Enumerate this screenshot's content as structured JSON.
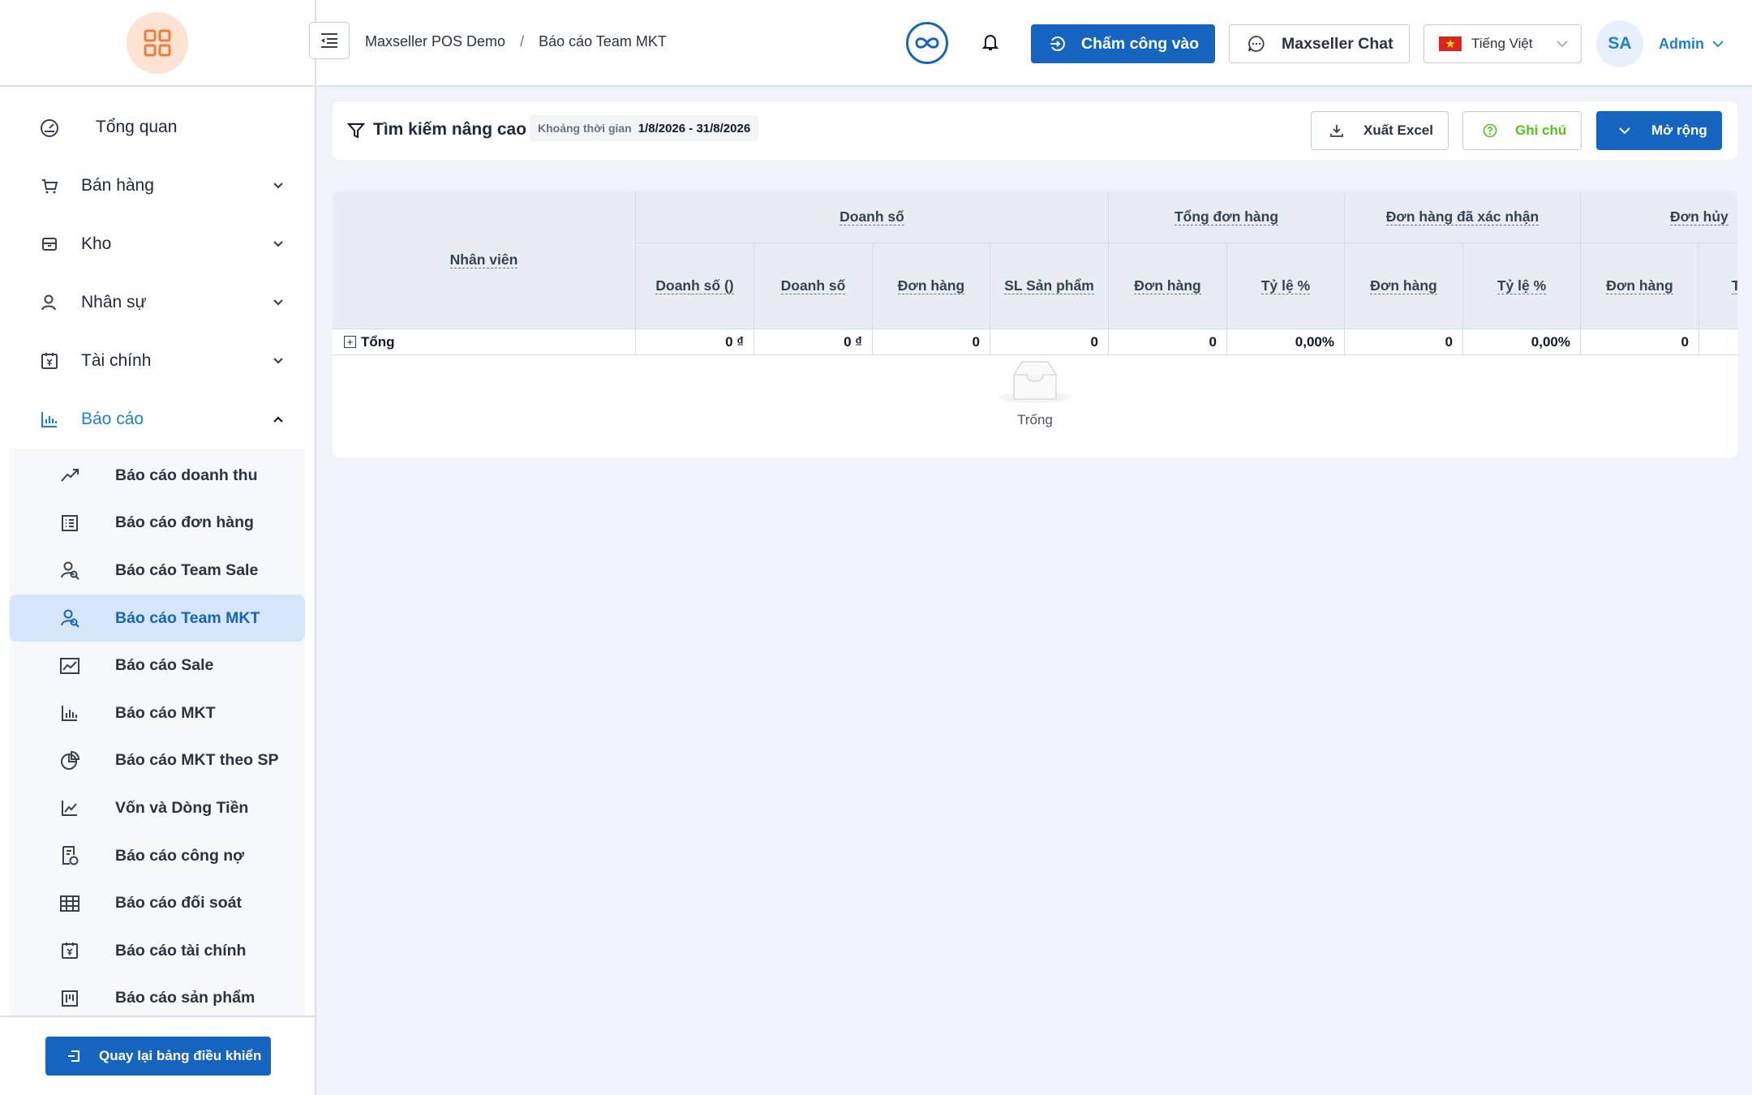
{
  "sidebar": {
    "menu": [
      {
        "label": "Tổng quan"
      },
      {
        "label": "Bán hàng"
      },
      {
        "label": "Kho"
      },
      {
        "label": "Nhân sự"
      },
      {
        "label": "Tài chính"
      },
      {
        "label": "Báo cáo"
      }
    ],
    "reports": [
      {
        "label": "Báo cáo doanh thu",
        "icon": "trend-up-icon"
      },
      {
        "label": "Báo cáo đơn hàng",
        "icon": "order-list-icon"
      },
      {
        "label": "Báo cáo Team Sale",
        "icon": "team-icon"
      },
      {
        "label": "Báo cáo Team MKT",
        "icon": "team-icon"
      },
      {
        "label": "Báo cáo Sale",
        "icon": "area-chart-icon"
      },
      {
        "label": "Báo cáo MKT",
        "icon": "bar-chart-icon"
      },
      {
        "label": "Báo cáo MKT theo SP",
        "icon": "pie-chart-icon"
      },
      {
        "label": "Vốn và Dòng Tiền",
        "icon": "line-chart-icon"
      },
      {
        "label": "Báo cáo công nợ",
        "icon": "debt-doc-icon"
      },
      {
        "label": "Báo cáo đối soát",
        "icon": "table-icon"
      },
      {
        "label": "Báo cáo tài chính",
        "icon": "calendar-yen-icon"
      },
      {
        "label": "Báo cáo sản phẩm",
        "icon": "product-icon"
      }
    ],
    "back_label": "Quay lại bảng điều khiển"
  },
  "header": {
    "breadcrumb": [
      "Maxseller POS Demo",
      "Báo cáo Team MKT"
    ],
    "checkin_label": "Chấm công vào",
    "chat_label": "Maxseller Chat",
    "language": "Tiếng Việt",
    "avatar": "SA",
    "user": "Admin"
  },
  "filter": {
    "title": "Tìm kiếm nâng cao",
    "date_label": "Khoảng thời gian",
    "date_value": "1/8/2026 - 31/8/2026",
    "excel_label": "Xuất Excel",
    "note_label": "Ghi chú",
    "expand_label": "Mở rộng"
  },
  "table": {
    "employee_header": "Nhân viên",
    "groups": [
      "Doanh số",
      "Tổng đơn hàng",
      "Đơn hàng đã xác nhận",
      "Đơn hủy"
    ],
    "columns": [
      "Doanh số ()",
      "Doanh số",
      "Đơn hàng",
      "SL Sản phẩm",
      "Đơn hàng",
      "Tỷ lệ %",
      "Đơn hàng",
      "Tỷ lệ %",
      "Đơn hàng",
      "T"
    ],
    "total_label": "Tổng",
    "total_values": [
      "0 ₫",
      "0 ₫",
      "0",
      "0",
      "0",
      "0,00%",
      "0",
      "0,00%",
      "0",
      ""
    ],
    "empty_text": "Trống"
  },
  "colors": {
    "primary": "#1565c0",
    "accent": "#1d7fd6",
    "success": "#52c41a",
    "logo_bg": "#fde3d4",
    "logo_fg": "#f07c3a"
  }
}
